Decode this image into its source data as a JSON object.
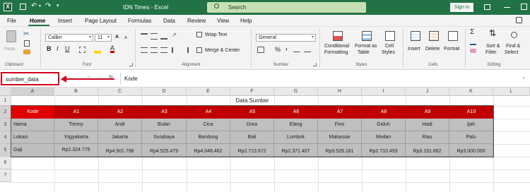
{
  "titlebar": {
    "filename": "IDN Times",
    "separator": "-",
    "app": "Excel",
    "search_placeholder": "Search",
    "signin_label": "Sign in"
  },
  "tabs": [
    "File",
    "Home",
    "Insert",
    "Page Layout",
    "Formulas",
    "Data",
    "Review",
    "View",
    "Help"
  ],
  "active_tab": "Home",
  "ribbon": {
    "clipboard": {
      "label": "Clipboard",
      "paste": "Paste"
    },
    "font": {
      "label": "Font",
      "name": "Calibri",
      "size": "11"
    },
    "alignment": {
      "label": "Alignment",
      "wrap": "Wrap Text",
      "merge": "Merge & Center"
    },
    "number": {
      "label": "Number",
      "format": "General",
      "percent": "%"
    },
    "styles": {
      "label": "Styles",
      "conditional": [
        "Conditional",
        "Formatting"
      ],
      "format_table": [
        "Format as",
        "Table"
      ],
      "cell_styles": [
        "Cell",
        "Styles"
      ]
    },
    "cells": {
      "label": "Cells",
      "insert": "Insert",
      "delete": "Delete",
      "format": "Format"
    },
    "editing": {
      "label": "Editing",
      "sort": [
        "Sort &",
        "Filter"
      ],
      "find": [
        "Find &",
        "Select"
      ]
    }
  },
  "formula_bar": {
    "name_box": "sumber_data",
    "fx": "fx",
    "value": "Kode"
  },
  "sheet": {
    "col_headers": [
      "A",
      "B",
      "C",
      "D",
      "E",
      "F",
      "G",
      "H",
      "I",
      "J",
      "K",
      "L"
    ],
    "row_headers": [
      "1",
      "2",
      "3",
      "4",
      "5",
      "6",
      "7"
    ],
    "title": "Data Sumber",
    "header_row": [
      "Kode",
      "A1",
      "A2",
      "A3",
      "A4",
      "A5",
      "A6",
      "A7",
      "A8",
      "A9",
      "A10"
    ],
    "rows": [
      [
        "Nama",
        "Timmy",
        "Andi",
        "Bulan",
        "Cica",
        "Dora",
        "Elang",
        "Fino",
        "Galuh",
        "Hadi",
        "Ijah"
      ],
      [
        "Lokasi",
        "Yogyakarta",
        "Jakarta",
        "Surabaya",
        "Bandung",
        "Bali",
        "Lombok",
        "Makassar",
        "Medan",
        "Riau",
        "Palu"
      ],
      [
        "Gaji",
        "Rp2.324.775",
        "Rp4.901.798",
        "Rp4.525.479",
        "Rp4.048.462",
        "Rp2.713.672",
        "Rp2.371.407",
        "Rp3.529.181",
        "Rp2.710.493",
        "Rp3.191.662",
        "Rp3.000.000"
      ]
    ]
  },
  "colors": {
    "excel_green": "#217346",
    "header_red": "#c00000",
    "selection_gray": "#bfbfbf",
    "callout_red": "#d0021b"
  }
}
